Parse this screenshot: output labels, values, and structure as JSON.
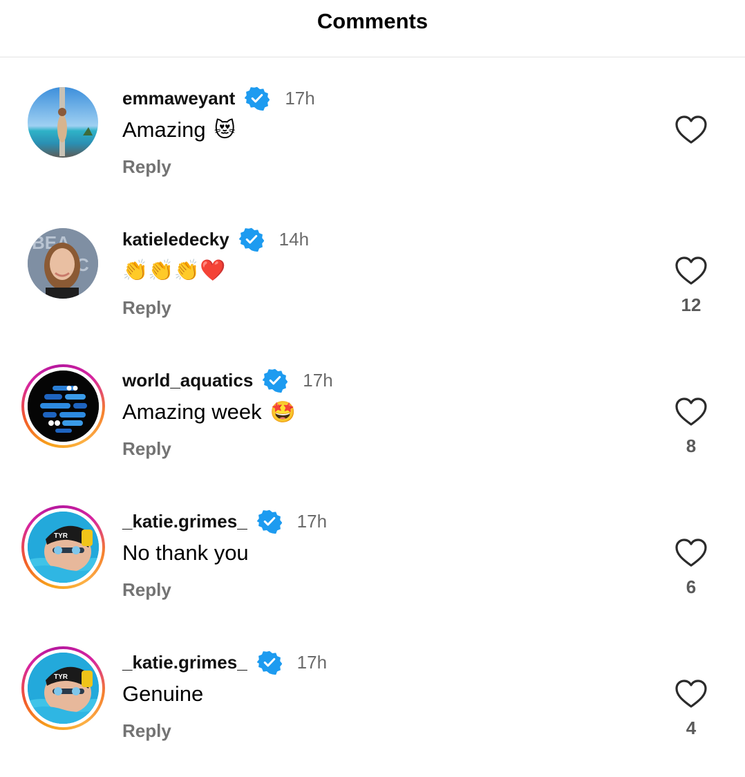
{
  "header": {
    "title": "Comments"
  },
  "colors": {
    "verified": "#1d9bf0",
    "muted": "#737373",
    "divider": "#e3e3e3"
  },
  "comments": [
    {
      "username": "emmaweyant",
      "time": "17h",
      "text": "Amazing",
      "emoji": "😻",
      "reply_label": "Reply",
      "likes": "",
      "story_ring": false,
      "avatar": "beach-photo"
    },
    {
      "username": "katieledecky",
      "time": "14h",
      "text": "",
      "emoji": "👏👏👏❤️",
      "reply_label": "Reply",
      "likes": "12",
      "story_ring": false,
      "avatar": "portrait-photo"
    },
    {
      "username": "world_aquatics",
      "time": "17h",
      "text": "Amazing week",
      "emoji": "🤩",
      "reply_label": "Reply",
      "likes": "8",
      "story_ring": true,
      "avatar": "world-aquatics-logo"
    },
    {
      "username": "_katie.grimes_",
      "time": "17h",
      "text": "No thank you",
      "emoji": "",
      "reply_label": "Reply",
      "likes": "6",
      "story_ring": true,
      "avatar": "swimmer-photo"
    },
    {
      "username": "_katie.grimes_",
      "time": "17h",
      "text": "Genuine",
      "emoji": "",
      "reply_label": "Reply",
      "likes": "4",
      "story_ring": true,
      "avatar": "swimmer-photo"
    }
  ]
}
